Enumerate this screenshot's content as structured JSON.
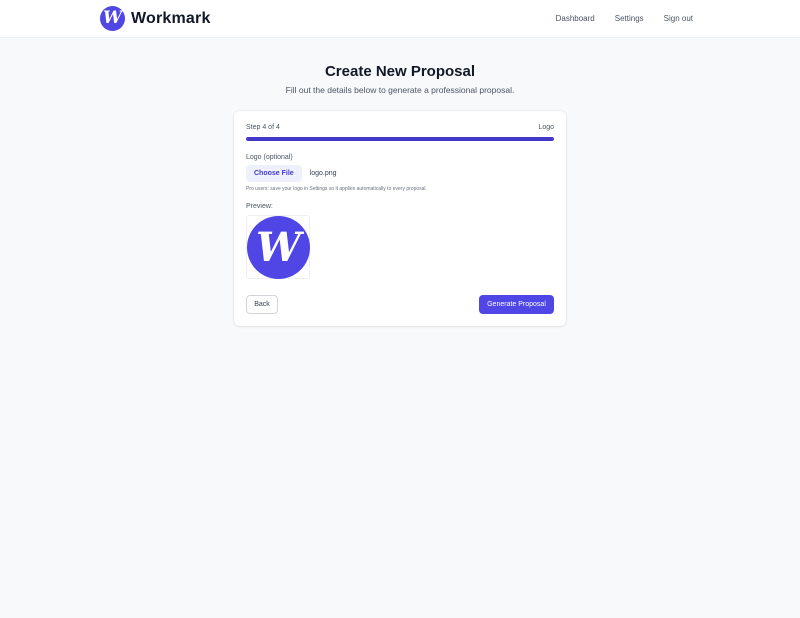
{
  "header": {
    "brand_name": "Workmark",
    "logo_letter": "W",
    "nav": [
      {
        "label": "Dashboard"
      },
      {
        "label": "Settings"
      },
      {
        "label": "Sign out"
      }
    ]
  },
  "page": {
    "title": "Create New Proposal",
    "subtitle": "Fill out the details below to generate a professional proposal."
  },
  "wizard": {
    "step_text": "Step 4 of 4",
    "step_name": "Logo",
    "progress": 1.0,
    "field_label": "Logo (optional)",
    "choose_file_label": "Choose File",
    "file_name": "logo.png",
    "hint": "Pro users: save your logo in Settings so it applies automatically to every proposal.",
    "preview_label": "Preview:",
    "preview_letter": "W",
    "back_label": "Back",
    "generate_label": "Generate Proposal"
  },
  "colors": {
    "accent": "#4f46e5",
    "progress": "#4338ca",
    "background": "#f8f9fb"
  },
  "icons": {
    "brand": "workmark-logo-icon",
    "preview": "logo-preview-image"
  }
}
